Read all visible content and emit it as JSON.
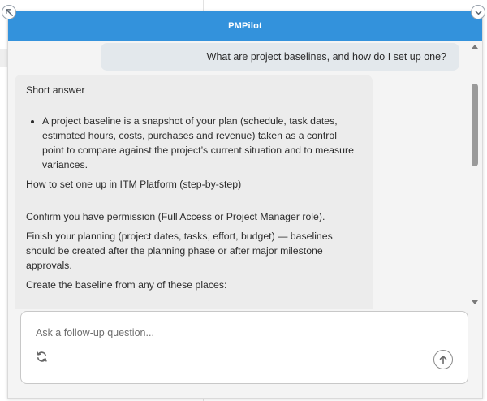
{
  "panel": {
    "title": "PMPilot"
  },
  "chat": {
    "user_message": "What are project baselines, and how do I set up one?",
    "assistant": {
      "heading": "Short answer",
      "bullet": "A project baseline is a snapshot of your plan (schedule, task dates, estimated hours, costs, purchases and revenue) taken as a control point to compare against the project’s current situation and to measure variances.",
      "howto_heading": "How to set one up in ITM Platform (step-by-step)",
      "step_1": "Confirm you have permission (Full Access or Project Manager role).",
      "step_2": "Finish your planning (project dates, tasks, effort, budget) — baselines should be created after the planning phase or after major milestone approvals.",
      "step_3": "Create the baseline from any of these places:"
    }
  },
  "composer": {
    "placeholder": "Ask a follow-up question..."
  },
  "icons": {
    "expand": "expand-diagonal-icon",
    "collapse": "chevron-down-icon",
    "refresh": "refresh-icon",
    "send": "arrow-up-icon"
  },
  "colors": {
    "header": "#3392dc",
    "user_bubble": "#e3e8ec",
    "assistant_bubble": "#ececec"
  }
}
